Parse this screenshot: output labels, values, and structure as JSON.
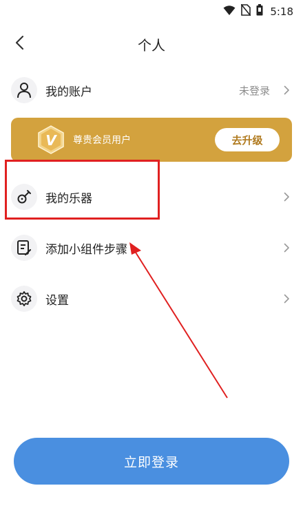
{
  "status_bar": {
    "time": "5:18"
  },
  "header": {
    "title": "个人"
  },
  "account": {
    "label": "我的账户",
    "value": "未登录"
  },
  "vip": {
    "text": "尊贵会员用户",
    "upgrade_label": "去升级"
  },
  "menu": [
    {
      "label": "我的乐器"
    },
    {
      "label": "添加小组件步骤"
    },
    {
      "label": "设置"
    }
  ],
  "login": {
    "label": "立即登录"
  },
  "colors": {
    "vip_gold": "#d3a23e",
    "login_blue": "#4a8fe0",
    "annotation_red": "#e02020"
  },
  "icons": [
    "back-icon",
    "user-icon",
    "vip-badge-icon",
    "guitar-icon",
    "note-edit-icon",
    "gear-icon",
    "chevron-right-icon",
    "wifi-icon",
    "no-sim-icon",
    "battery-icon"
  ]
}
